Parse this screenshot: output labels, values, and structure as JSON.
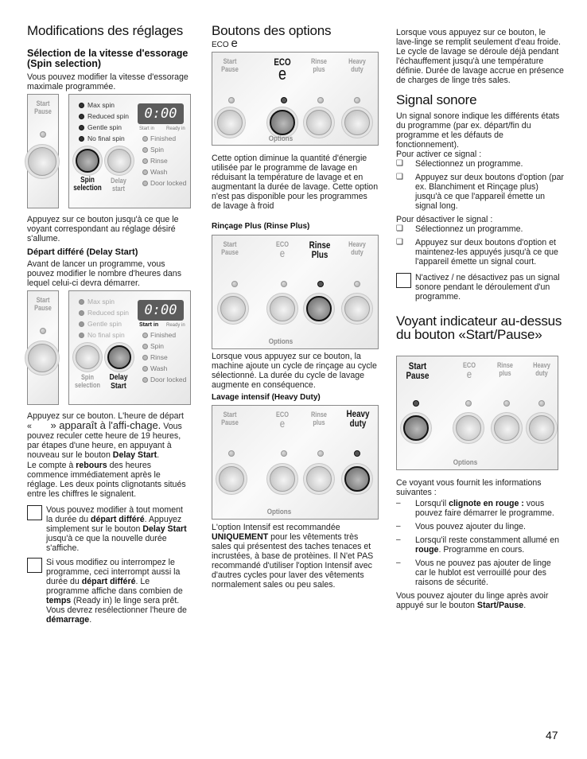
{
  "page_number": "47",
  "col1": {
    "title": "Modifications des réglages",
    "spin_heading": "Sélection de la vitesse d'essorage (Spin selection)",
    "spin_intro": "Vous pouvez modifier la vitesse d'essorage maximale programmée.",
    "spin_after": "Appuyez sur ce bouton jusqu'à ce que le voyant correspondant au réglage désiré s'allume.",
    "delay_heading": "Départ différé (Delay Start)",
    "delay_intro": "Avant de lancer un programme, vous pouvez modifier le nombre d'heures dans lequel celui-ci devra démarrer.",
    "delay_after_1": "Appuyez sur ce bouton. L'heure de départ «",
    "delay_after_2": "» apparaît à l'affi-chage.",
    "delay_after_3": " Vous pouvez reculer cette heure de 19 heures, par étapes d'une heure, en appuyant à nouveau sur le bouton ",
    "delay_after_bold": "Delay Start",
    "delay_after_end": ".",
    "countdown_1": "Le compte à ",
    "countdown_bold": "rebours",
    "countdown_2": " des heures commence immédiatement après le réglage. Les deux points clignotants situés entre les chiffres le signalent.",
    "note1": {
      "t1": "Vous pouvez modifier à tout moment la durée du ",
      "b1": "départ différé",
      "t2": ". Appuyez simplement sur le bouton ",
      "b2": "Delay Start",
      "t3": " jusqu'à ce que la nouvelle durée s'affiche."
    },
    "note2": {
      "t1": "Si vous modifiez ou interrompez le programme, ceci interrompt aussi la durée du ",
      "b1": "départ différé",
      "t2": ". Le programme affiche dans combien de ",
      "b2": "temps",
      "t3": " (Ready in) le linge sera prêt. Vous devrez resélectionner l'heure de ",
      "b3": "démarrage",
      "t4": "."
    },
    "panel": {
      "start_pause": "Start Pause",
      "spin_options": [
        "Max spin",
        "Reduced spin",
        "Gentle spin",
        "No final spin"
      ],
      "display": "0:00",
      "start_in": "Start in",
      "ready_in": "Ready in",
      "status": [
        "Finished",
        "Spin",
        "Rinse",
        "Wash",
        "Door locked"
      ],
      "spin_selection": "Spin selection",
      "delay_start": "Delay start",
      "delay_start_active": "Delay Start"
    }
  },
  "col2": {
    "title": "Boutons des options",
    "eco_heading": "ECO",
    "eco_symbol": "e",
    "eco_text": "Cette option diminue la quantité d'énergie utilisée par le programme de lavage en réduisant la température de lavage et en augmentant la durée de lavage.  Cette option n'est pas disponible pour les programmes de lavage à froid",
    "rinse_heading": "Rinçage Plus (Rinse Plus)",
    "rinse_text": "Lorsque vous appuyez sur ce bouton, la machine ajoute un cycle de rinçage au cycle sélectionné. La durée du cycle de lavage augmente en conséquence.",
    "heavy_heading": "Lavage intensif (Heavy Duty)",
    "heavy_t1": "L'option Intensif est recommandée ",
    "heavy_b1": "UNIQUEMENT",
    "heavy_t2": " pour les vêtements très sales qui présentest des taches tenaces et incrustées, à base de protèines.  Il N'et PAS recommandé d'utiliser l'option Intensif avec d'autres cycles pour laver des vêtements normalement sales ou peu sales.",
    "panel": {
      "start": "Start",
      "pause": "Pause",
      "eco": "ECO",
      "e": "e",
      "rinse": "Rinse",
      "plus": "plus",
      "plus_active": "Plus",
      "heavy": "Heavy",
      "duty": "duty",
      "options": "Options"
    }
  },
  "col3": {
    "heavy_cont": "Lorsque vous appuyez sur ce bouton, le lave-linge se remplit seulement d'eau froide. Le cycle de lavage se déroule déjà pendant l'échauffement jusqu'à une température définie. Durée de lavage accrue en présence de charges de linge très sales.",
    "signal_title": "Signal sonore",
    "signal_intro": "Un signal sonore indique les différents états du programme (par ex. départ/fin du programme et les défauts de fonctionnement).",
    "activate_label": "Pour activer ce signal :",
    "activate_steps": [
      "Sélectionnez un programme.",
      "Appuyez sur deux boutons d'option (par ex. Blanchiment et Rinçage plus) jusqu'à ce que l'appareil émette un signal long."
    ],
    "deactivate_label": "Pour désactiver le signal :",
    "deactivate_steps": [
      "Sélectionnez un programme.",
      "Appuyez sur deux boutons d'option et maintenez-les appuyés jusqu'à ce que l'appareil émette un signal court."
    ],
    "note": "N'activez / ne désactivez pas un signal sonore pendant le déroulement d'un programme.",
    "voyant_title": "Voyant indicateur au-dessus du bouton «Start/Pause»",
    "voyant_intro": "Ce voyant vous fournit les informations suivantes :",
    "voyant_items": [
      {
        "t1": "Lorsqu'il ",
        "b": "clignote en rouge :",
        "t2": " vous pouvez faire démarrer le programme."
      },
      {
        "t1": "Vous pouvez ajouter du linge.",
        "b": "",
        "t2": ""
      },
      {
        "t1": "Lorsqu'il reste constamment allumé en ",
        "b": "rouge",
        "t2": ". Programme en cours."
      },
      {
        "t1": "Vous ne pouvez pas ajouter de linge car le hublot est verrouillé pour des raisons de sécurité.",
        "b": "",
        "t2": ""
      }
    ],
    "voyant_end_1": "Vous pouvez ajouter du linge après avoir appuyé sur le bouton ",
    "voyant_end_bold": "Start/Pause",
    "voyant_end_2": ".",
    "bullet_square": "❑",
    "bullet_dash": "–"
  }
}
